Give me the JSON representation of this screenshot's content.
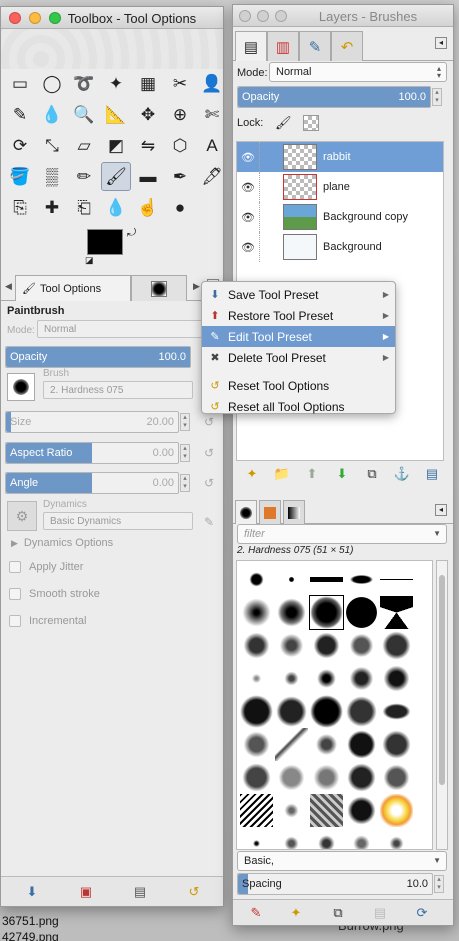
{
  "desktop": {
    "files": [
      "36751.png",
      "42749.png"
    ],
    "bottom_file": "Burrow.png"
  },
  "toolbox": {
    "title": "Toolbox - Tool Options",
    "tools": [
      [
        "rect-select-icon",
        "▭"
      ],
      [
        "ellipse-select-icon",
        "◯"
      ],
      [
        "free-select-icon",
        "➰"
      ],
      [
        "fuzzy-select-icon",
        "✦"
      ],
      [
        "color-select-icon",
        "▦"
      ],
      [
        "scissors-icon",
        "✂"
      ],
      [
        "foreground-select-icon",
        "👤"
      ],
      [
        "paths-icon",
        "✎"
      ],
      [
        "color-picker-icon",
        "💧"
      ],
      [
        "zoom-icon",
        "🔍"
      ],
      [
        "measure-icon",
        "📐"
      ],
      [
        "move-icon",
        "✥"
      ],
      [
        "align-icon",
        "⊕"
      ],
      [
        "crop-icon",
        "✄"
      ],
      [
        "rotate-icon",
        "⟳"
      ],
      [
        "scale-icon",
        "⤡"
      ],
      [
        "shear-icon",
        "▱"
      ],
      [
        "perspective-icon",
        "◩"
      ],
      [
        "flip-icon",
        "⇋"
      ],
      [
        "cage-icon",
        "⬡"
      ],
      [
        "text-icon",
        "A"
      ],
      [
        "bucket-fill-icon",
        "🪣"
      ],
      [
        "blend-icon",
        "▒"
      ],
      [
        "pencil-icon",
        "✏"
      ],
      [
        "paintbrush-icon",
        "🖌"
      ],
      [
        "eraser-icon",
        "▬"
      ],
      [
        "airbrush-icon",
        "✒"
      ],
      [
        "ink-icon",
        "🖋"
      ],
      [
        "clone-icon",
        "⎘"
      ],
      [
        "heal-icon",
        "✚"
      ],
      [
        "perspective-clone-icon",
        "⎗"
      ],
      [
        "blur-icon",
        "💧"
      ],
      [
        "smudge-icon",
        "☝"
      ],
      [
        "dodge-burn-icon",
        "●"
      ],
      [
        "",
        ""
      ]
    ],
    "tab_label": "Tool Options",
    "panel_title": "Paintbrush",
    "mode_label": "Mode:",
    "mode_value": "Normal",
    "opacity_label": "Opacity",
    "opacity_value": "100.0",
    "brush_label": "Brush",
    "brush_value": "2. Hardness 075",
    "size_label": "Size",
    "size_value": "20.00",
    "aspect_label": "Aspect Ratio",
    "aspect_value": "0.00",
    "angle_label": "Angle",
    "angle_value": "0.00",
    "dynamics_label": "Dynamics",
    "dynamics_value": "Basic Dynamics",
    "dynamics_options": "Dynamics Options",
    "apply_jitter": "Apply Jitter",
    "smooth_stroke": "Smooth stroke",
    "incremental": "Incremental"
  },
  "menu": {
    "items": [
      {
        "label": "Save Tool Preset",
        "icon": "⬇",
        "sub": "▶"
      },
      {
        "label": "Restore Tool Preset",
        "icon": "⬆",
        "sub": "▶"
      },
      {
        "label": "Edit Tool Preset",
        "icon": "✎",
        "sub": "▶"
      },
      {
        "label": "Delete Tool Preset",
        "icon": "✖",
        "sub": "▶"
      },
      {
        "label": "Reset Tool Options",
        "icon": "↺",
        "sub": ""
      },
      {
        "label": "Reset all Tool Options",
        "icon": "↺",
        "sub": ""
      }
    ]
  },
  "layers": {
    "title": "Layers - Brushes",
    "mode_label": "Mode:",
    "mode_value": "Normal",
    "opacity_label": "Opacity",
    "opacity_value": "100.0",
    "lock_label": "Lock:",
    "items": [
      {
        "name": "rabbit",
        "selected": true
      },
      {
        "name": "plane",
        "selected": false
      },
      {
        "name": "Background copy",
        "selected": false
      },
      {
        "name": "Background",
        "selected": false
      }
    ]
  },
  "brushes": {
    "filter_placeholder": "filter",
    "current": "2. Hardness 075 (51 × 51)",
    "tag_value": "Basic,",
    "spacing_label": "Spacing",
    "spacing_value": "10.0"
  },
  "colors": {
    "accent": "#6f9ed6",
    "slider_fill": "#6d97c6",
    "window_bg": "#ececec"
  }
}
